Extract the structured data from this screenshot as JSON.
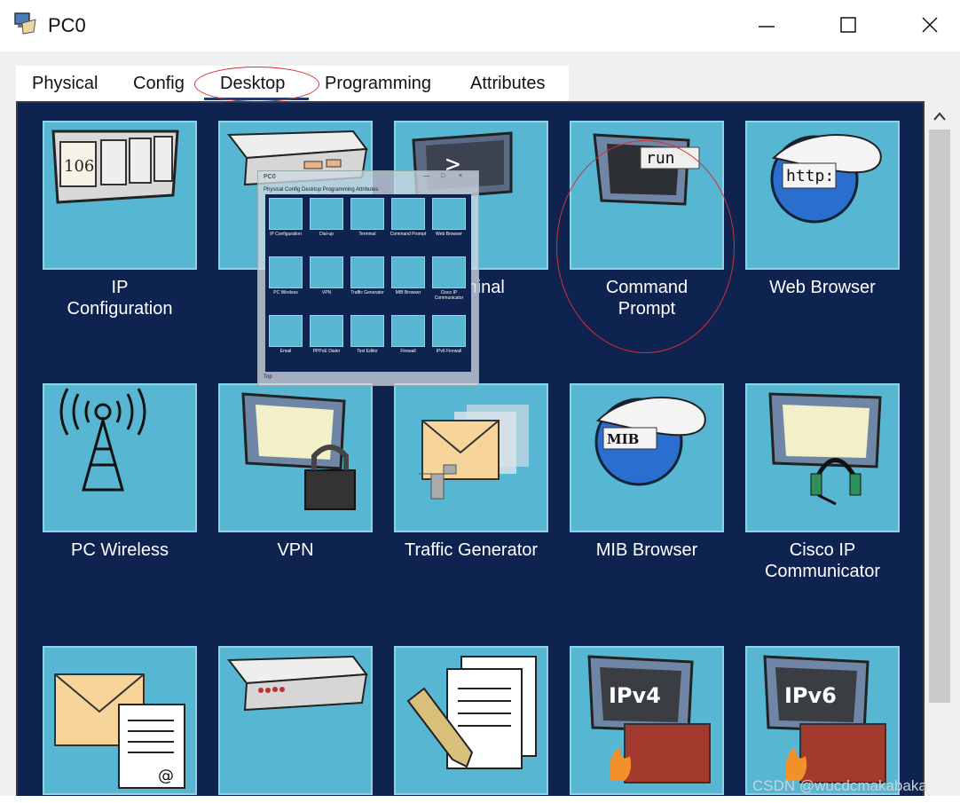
{
  "window": {
    "title": "PC0",
    "icon": "pc-device-icon",
    "controls": [
      "minimize-icon",
      "maximize-icon",
      "close-icon"
    ]
  },
  "tabs": [
    {
      "label": "Physical",
      "active": false
    },
    {
      "label": "Config",
      "active": false
    },
    {
      "label": "Desktop",
      "active": true
    },
    {
      "label": "Programming",
      "active": false
    },
    {
      "label": "Attributes",
      "active": false
    }
  ],
  "apps": [
    {
      "label": "IP\nConfiguration",
      "icon": "ip-configuration-icon",
      "tile_text": "106"
    },
    {
      "label": "Dial-up",
      "icon": "dial-up-modem-icon"
    },
    {
      "label": "Terminal",
      "icon": "terminal-icon",
      "tile_text": ">"
    },
    {
      "label": "Command\nPrompt",
      "icon": "command-prompt-icon",
      "tile_text": "run"
    },
    {
      "label": "Web Browser",
      "icon": "web-browser-icon",
      "tile_text": "http:"
    },
    {
      "label": "PC Wireless",
      "icon": "wireless-tower-icon"
    },
    {
      "label": "VPN",
      "icon": "vpn-lock-icon"
    },
    {
      "label": "Traffic Generator",
      "icon": "traffic-generator-icon"
    },
    {
      "label": "MIB Browser",
      "icon": "mib-browser-icon",
      "tile_text": "MIB"
    },
    {
      "label": "Cisco IP\nCommunicator",
      "icon": "ip-communicator-icon"
    },
    {
      "label": "",
      "icon": "email-icon"
    },
    {
      "label": "",
      "icon": "pppoe-dialer-icon"
    },
    {
      "label": "",
      "icon": "text-editor-icon"
    },
    {
      "label": "",
      "icon": "ipv4-firewall-icon",
      "tile_text": "IPv4"
    },
    {
      "label": "",
      "icon": "ipv6-firewall-icon",
      "tile_text": "IPv6"
    }
  ],
  "thumbnail": {
    "title": "PC0",
    "controls": [
      "—",
      "□",
      "×"
    ],
    "tabs": "Physical   Config   Desktop   Programming   Attributes",
    "labels": [
      "IP Configuration",
      "Dial-up",
      "Terminal",
      "Command Prompt",
      "Web Browser",
      "PC Wireless",
      "VPN",
      "Traffic Generator",
      "MIB Browser",
      "Cisco IP Communicator",
      "Email",
      "PPPoE Dialer",
      "Text Editor",
      "Firewall",
      "IPv6 Firewall"
    ],
    "footer": "Top"
  },
  "watermark": "CSDN @wucdcmakabaka",
  "colors": {
    "panel": "#0e2350",
    "tile": "#57b7d2",
    "highlight_ellipse": "#d23030"
  }
}
